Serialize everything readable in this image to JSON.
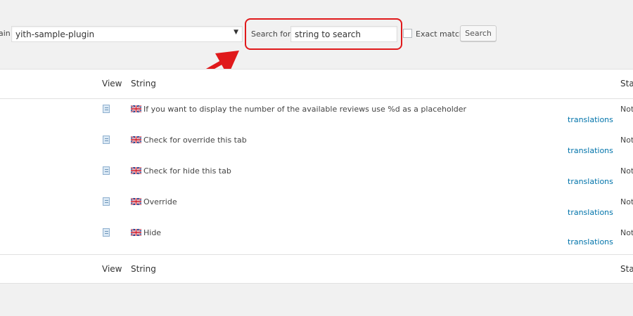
{
  "filters": {
    "domain_label": "ain:",
    "domain_value": "yith-sample-plugin",
    "search_label": "Search for:",
    "search_value": "string to search",
    "exact_label": "Exact match",
    "search_button": "Search"
  },
  "table": {
    "headers": {
      "view": "View",
      "string": "String",
      "status": "Sta"
    },
    "rows": [
      {
        "text": "If you want to display the number of the available reviews use %d as a placeholder",
        "link": "translations",
        "status": "Not"
      },
      {
        "text": "Check for override this tab",
        "link": "translations",
        "status": "Not"
      },
      {
        "text": "Check for hide this tab",
        "link": "translations",
        "status": "Not"
      },
      {
        "text": "Override",
        "link": "translations",
        "status": "Not"
      },
      {
        "text": "Hide",
        "link": "translations",
        "status": "Not"
      }
    ]
  },
  "colors": {
    "highlight": "#e0191b",
    "link": "#0073aa"
  }
}
